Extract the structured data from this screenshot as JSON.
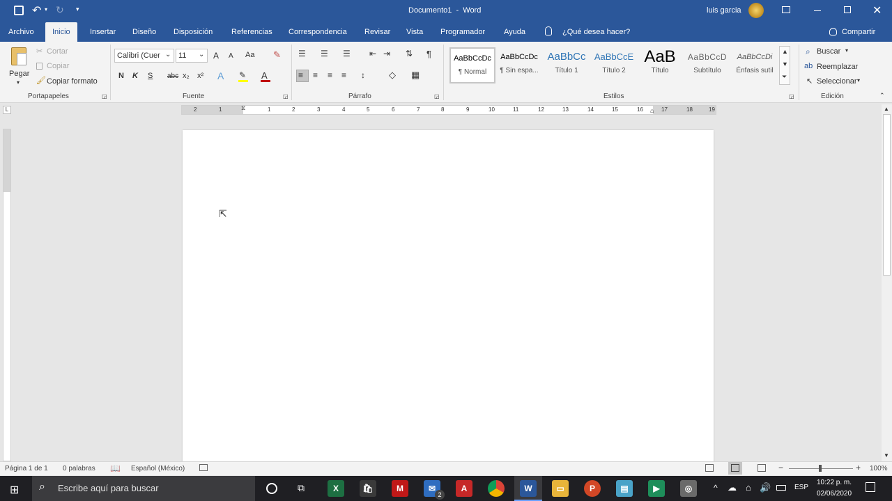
{
  "title": {
    "text": "Documento1  -  Word",
    "user_name": "luis garcia"
  },
  "tabs": [
    "Archivo",
    "Inicio",
    "Insertar",
    "Diseño",
    "Disposición",
    "Referencias",
    "Correspondencia",
    "Revisar",
    "Vista",
    "Programador",
    "Ayuda"
  ],
  "tell_me": "¿Qué desea hacer?",
  "share_label": "Compartir",
  "clipboard": {
    "paste": "Pegar",
    "cut": "Cortar",
    "copy": "Copiar",
    "format_painter": "Copiar formato",
    "group": "Portapapeles"
  },
  "font": {
    "name": "Calibri (Cuer",
    "size": "11",
    "bold": "N",
    "italic": "K",
    "underline": "S",
    "strike": "abc",
    "subscript": "x₂",
    "superscript": "x²",
    "change_case": "Aa",
    "grow": "A",
    "shrink": "A",
    "group": "Fuente"
  },
  "paragraph": {
    "group": "Párrafo",
    "pilcrow": "¶"
  },
  "styles": {
    "items": [
      {
        "preview": "AaBbCcDc",
        "name": "¶ Normal"
      },
      {
        "preview": "AaBbCcDc",
        "name": "¶ Sin espa..."
      },
      {
        "preview": "AaBbCc",
        "name": "Título 1"
      },
      {
        "preview": "AaBbCcE",
        "name": "Título 2"
      },
      {
        "preview": "AaB",
        "name": "Título"
      },
      {
        "preview": "AaBbCcD",
        "name": "Subtítulo"
      },
      {
        "preview": "AaBbCcDi",
        "name": "Énfasis sutil"
      }
    ],
    "group": "Estilos"
  },
  "editing": {
    "find": "Buscar",
    "replace": "Reemplazar",
    "select": "Seleccionar",
    "group": "Edición"
  },
  "ruler_numbers": [
    "2",
    "1",
    "1",
    "2",
    "3",
    "4",
    "5",
    "6",
    "7",
    "8",
    "9",
    "10",
    "11",
    "12",
    "13",
    "14",
    "15",
    "16",
    "17",
    "18",
    "19"
  ],
  "status": {
    "page": "Página 1 de 1",
    "words": "0 palabras",
    "language": "Español (México)",
    "zoom": "100%"
  },
  "taskbar": {
    "search_placeholder": "Escribe aquí para buscar",
    "time": "10:22 p. m.",
    "date": "02/06/2020",
    "lang": "ESP",
    "mail_badge": "2"
  },
  "colors": {
    "word_blue": "#2b579a",
    "ribbon_bg": "#f3f3f3",
    "taskbar_bg": "#1f1f23",
    "font_color_red": "#c00000",
    "highlight_yellow": "#ffff00"
  }
}
